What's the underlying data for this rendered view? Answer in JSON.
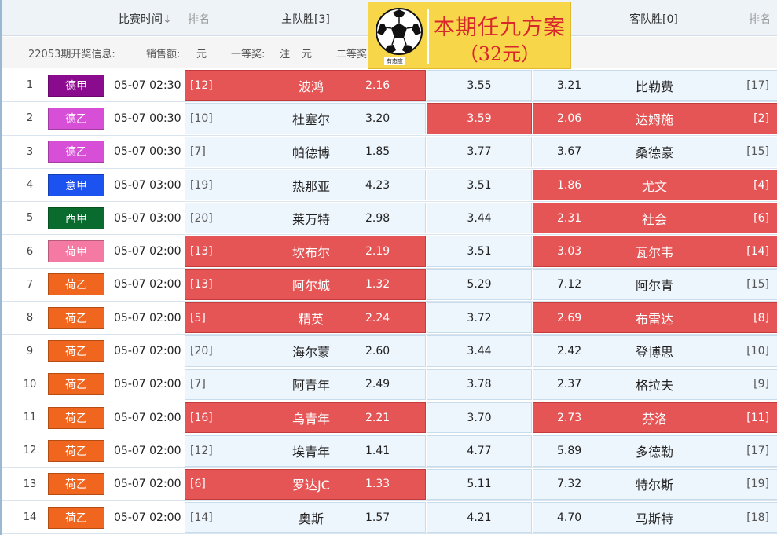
{
  "header": {
    "time_label": "比赛时间",
    "time_arrow": "↓",
    "rank_label_left": "排名",
    "home_label": "主队胜[3]",
    "away_label": "客队胜[0]",
    "rank_label_right": "排名"
  },
  "info": {
    "period": "22053期开奖信息:",
    "sales": "销售额:",
    "yuan": "元",
    "first": "一等奖:",
    "zhu": "注",
    "yuan2": "元",
    "second": "二等奖"
  },
  "banner": {
    "title": "本期任九方案",
    "price": "（32元）",
    "logo_caption": "有态度"
  },
  "colors": {
    "hot": "#e55555",
    "cool": "#eef6fd",
    "banner_bg": "#f7d64a",
    "banner_text": "#d8262b"
  },
  "rows": [
    {
      "num": "1",
      "league": "德甲",
      "league_color": "#8b0b8f",
      "time": "05-07 02:30",
      "home_rank": "[12]",
      "home": "波鸿",
      "home_odds": "2.16",
      "draw_odds": "3.55",
      "away_odds": "3.21",
      "away": "比勒费",
      "away_rank": "[17]",
      "home_hot": true,
      "draw_hot": false,
      "away_hot": false
    },
    {
      "num": "2",
      "league": "德乙",
      "league_color": "#d64fd6",
      "time": "05-07 00:30",
      "home_rank": "[10]",
      "home": "杜塞尔",
      "home_odds": "3.20",
      "draw_odds": "3.59",
      "away_odds": "2.06",
      "away": "达姆施",
      "away_rank": "[2]",
      "home_hot": false,
      "draw_hot": true,
      "away_hot": true
    },
    {
      "num": "3",
      "league": "德乙",
      "league_color": "#d64fd6",
      "time": "05-07 00:30",
      "home_rank": "[7]",
      "home": "帕德博",
      "home_odds": "1.85",
      "draw_odds": "3.77",
      "away_odds": "3.67",
      "away": "桑德豪",
      "away_rank": "[15]",
      "home_hot": false,
      "draw_hot": false,
      "away_hot": false
    },
    {
      "num": "4",
      "league": "意甲",
      "league_color": "#1c52ef",
      "time": "05-07 03:00",
      "home_rank": "[19]",
      "home": "热那亚",
      "home_odds": "4.23",
      "draw_odds": "3.51",
      "away_odds": "1.86",
      "away": "尤文",
      "away_rank": "[4]",
      "home_hot": false,
      "draw_hot": false,
      "away_hot": true
    },
    {
      "num": "5",
      "league": "西甲",
      "league_color": "#0a6b2e",
      "time": "05-07 03:00",
      "home_rank": "[20]",
      "home": "莱万特",
      "home_odds": "2.98",
      "draw_odds": "3.44",
      "away_odds": "2.31",
      "away": "社会",
      "away_rank": "[6]",
      "home_hot": false,
      "draw_hot": false,
      "away_hot": true
    },
    {
      "num": "6",
      "league": "荷甲",
      "league_color": "#f47aa4",
      "time": "05-07 02:00",
      "home_rank": "[13]",
      "home": "坎布尔",
      "home_odds": "2.19",
      "draw_odds": "3.51",
      "away_odds": "3.03",
      "away": "瓦尔韦",
      "away_rank": "[14]",
      "home_hot": true,
      "draw_hot": false,
      "away_hot": true
    },
    {
      "num": "7",
      "league": "荷乙",
      "league_color": "#f0661e",
      "time": "05-07 02:00",
      "home_rank": "[13]",
      "home": "阿尔城",
      "home_odds": "1.32",
      "draw_odds": "5.29",
      "away_odds": "7.12",
      "away": "阿尔青",
      "away_rank": "[15]",
      "home_hot": true,
      "draw_hot": false,
      "away_hot": false
    },
    {
      "num": "8",
      "league": "荷乙",
      "league_color": "#f0661e",
      "time": "05-07 02:00",
      "home_rank": "[5]",
      "home": "精英",
      "home_odds": "2.24",
      "draw_odds": "3.72",
      "away_odds": "2.69",
      "away": "布雷达",
      "away_rank": "[8]",
      "home_hot": true,
      "draw_hot": false,
      "away_hot": true
    },
    {
      "num": "9",
      "league": "荷乙",
      "league_color": "#f0661e",
      "time": "05-07 02:00",
      "home_rank": "[20]",
      "home": "海尔蒙",
      "home_odds": "2.60",
      "draw_odds": "3.44",
      "away_odds": "2.42",
      "away": "登博思",
      "away_rank": "[10]",
      "home_hot": false,
      "draw_hot": false,
      "away_hot": false
    },
    {
      "num": "10",
      "league": "荷乙",
      "league_color": "#f0661e",
      "time": "05-07 02:00",
      "home_rank": "[7]",
      "home": "阿青年",
      "home_odds": "2.49",
      "draw_odds": "3.78",
      "away_odds": "2.37",
      "away": "格拉夫",
      "away_rank": "[9]",
      "home_hot": false,
      "draw_hot": false,
      "away_hot": false
    },
    {
      "num": "11",
      "league": "荷乙",
      "league_color": "#f0661e",
      "time": "05-07 02:00",
      "home_rank": "[16]",
      "home": "乌青年",
      "home_odds": "2.21",
      "draw_odds": "3.70",
      "away_odds": "2.73",
      "away": "芬洛",
      "away_rank": "[11]",
      "home_hot": true,
      "draw_hot": false,
      "away_hot": true
    },
    {
      "num": "12",
      "league": "荷乙",
      "league_color": "#f0661e",
      "time": "05-07 02:00",
      "home_rank": "[12]",
      "home": "埃青年",
      "home_odds": "1.41",
      "draw_odds": "4.77",
      "away_odds": "5.89",
      "away": "多德勒",
      "away_rank": "[17]",
      "home_hot": false,
      "draw_hot": false,
      "away_hot": false
    },
    {
      "num": "13",
      "league": "荷乙",
      "league_color": "#f0661e",
      "time": "05-07 02:00",
      "home_rank": "[6]",
      "home": "罗达JC",
      "home_odds": "1.33",
      "draw_odds": "5.11",
      "away_odds": "7.32",
      "away": "特尔斯",
      "away_rank": "[19]",
      "home_hot": true,
      "draw_hot": false,
      "away_hot": false
    },
    {
      "num": "14",
      "league": "荷乙",
      "league_color": "#f0661e",
      "time": "05-07 02:00",
      "home_rank": "[14]",
      "home": "奥斯",
      "home_odds": "1.57",
      "draw_odds": "4.21",
      "away_odds": "4.70",
      "away": "马斯特",
      "away_rank": "[18]",
      "home_hot": false,
      "draw_hot": false,
      "away_hot": false
    }
  ]
}
